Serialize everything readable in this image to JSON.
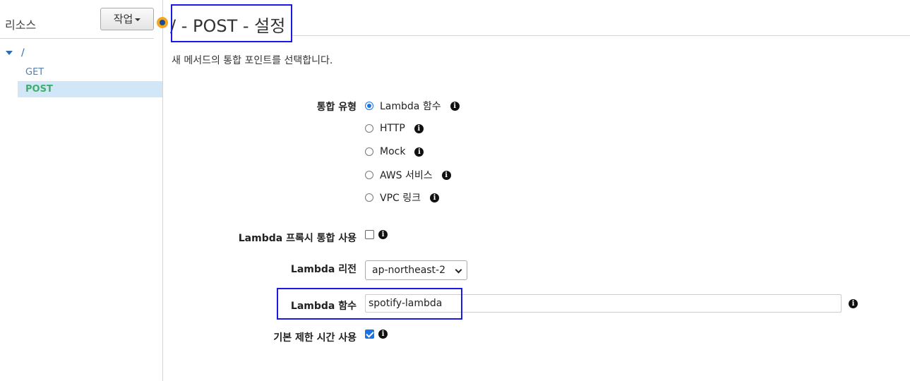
{
  "sidebar": {
    "title": "리소스",
    "actions_label": "작업",
    "root_path": "/",
    "methods": [
      "GET",
      "POST"
    ]
  },
  "main": {
    "title": "/ - POST - 설정",
    "subtitle": "새 메서드의 통합 포인트를 선택합니다.",
    "integration_type": {
      "label": "통합 유형",
      "options": [
        "Lambda 함수",
        "HTTP",
        "Mock",
        "AWS 서비스",
        "VPC 링크"
      ],
      "selected": "Lambda 함수"
    },
    "proxy": {
      "label": "Lambda 프록시 통합 사용",
      "checked": false
    },
    "region": {
      "label": "Lambda 리전",
      "value": "ap-northeast-2"
    },
    "function": {
      "label": "Lambda 함수",
      "value": "spotify-lambda"
    },
    "timeout": {
      "label": "기본 제한 시간 사용",
      "checked": true
    }
  },
  "colors": {
    "accent": "#1a73e8",
    "annotation_box": "#1a1ae6",
    "selected_row": "#d1e6f7",
    "post_method": "#3fae6b"
  }
}
